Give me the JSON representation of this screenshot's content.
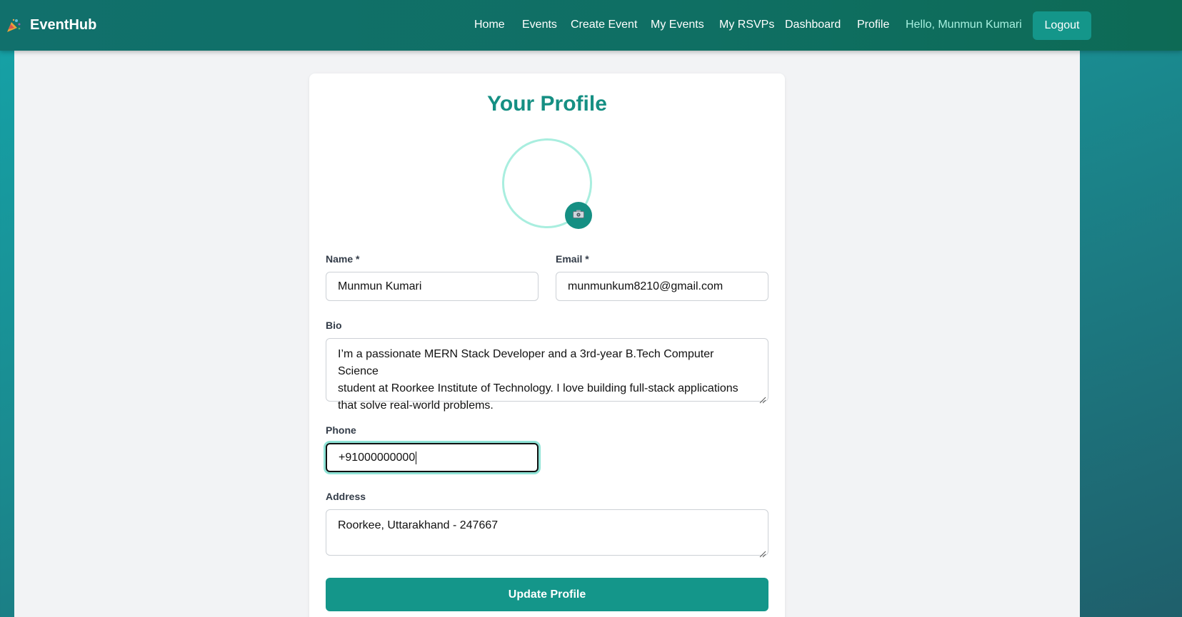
{
  "brand": {
    "name": "EventHub",
    "icon": "party-popper-icon"
  },
  "nav": {
    "links": [
      "Home",
      "Events",
      "Create Event",
      "My Events",
      "My RSVPs",
      "Dashboard",
      "Profile"
    ],
    "greeting": "Hello, Munmun Kumari",
    "logout_label": "Logout"
  },
  "profile": {
    "title": "Your Profile",
    "camera_icon": "camera-icon",
    "name_label": "Name *",
    "name_value": "Munmun Kumari",
    "email_label": "Email *",
    "email_value": "munmunkum8210@gmail.com",
    "bio_label": "Bio",
    "bio_lines": [
      "I’m a passionate MERN Stack Developer and a 3rd-year B.Tech Computer Science",
      "student at Roorkee Institute of Technology. I love building full-stack applications",
      "that solve real-world problems."
    ],
    "phone_label": "Phone",
    "phone_value": "+91000000000",
    "address_label": "Address",
    "address_value": "Roorkee, Uttarakhand - 247667",
    "update_label": "Update Profile"
  },
  "colors": {
    "accent": "#14968a",
    "title": "#158f83",
    "nav_bg": "#0f6f63",
    "greeting": "#a6f0e0"
  }
}
